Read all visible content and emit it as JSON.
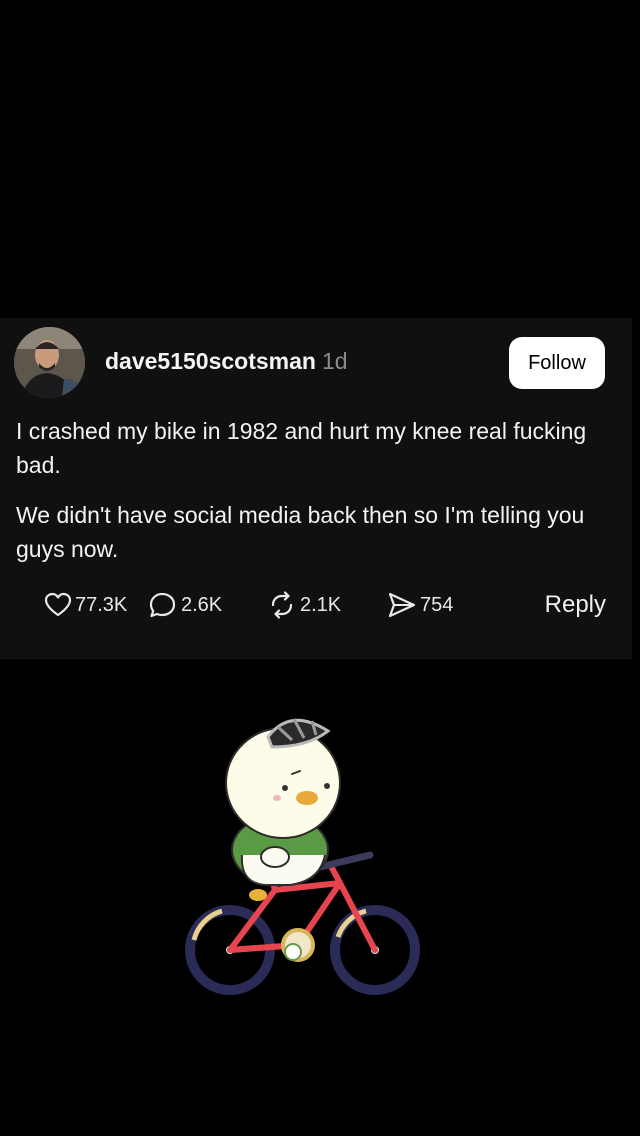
{
  "post": {
    "username": "dave5150scotsman",
    "timestamp": "1d",
    "follow_label": "Follow",
    "paragraphs": [
      "I crashed my bike in 1982 and hurt my knee real fucking bad.",
      "We didn't have social media back then so I'm telling you guys now."
    ],
    "actions": {
      "likes": "77.3K",
      "comments": "2.6K",
      "reposts": "2.1K",
      "shares": "754",
      "reply_label": "Reply"
    },
    "icons": {
      "like": "heart-icon",
      "comment": "comment-bubble-icon",
      "repost": "repost-arrows-icon",
      "share": "paper-plane-icon"
    }
  },
  "colors": {
    "background": "#000000",
    "card": "#101010",
    "text": "#f3f3f3",
    "muted": "#8a8a8a",
    "follow_bg": "#ffffff"
  }
}
